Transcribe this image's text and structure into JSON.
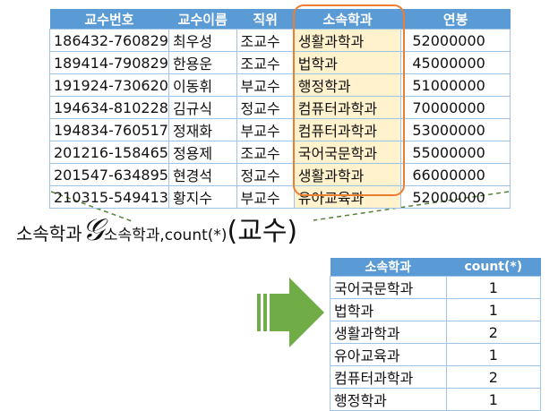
{
  "professor_table": {
    "headers": [
      "교수번호",
      "교수이름",
      "직위",
      "소속학과",
      "연봉"
    ],
    "rows": [
      [
        "186432-760829",
        "최우성",
        "조교수",
        "생활과학과",
        "52000000"
      ],
      [
        "189414-790829",
        "한용운",
        "조교수",
        "법학과",
        "45000000"
      ],
      [
        "191924-730620",
        "이동휘",
        "부교수",
        "행정학과",
        "51000000"
      ],
      [
        "194634-810228",
        "김규식",
        "정교수",
        "컴퓨터과학과",
        "70000000"
      ],
      [
        "194834-760517",
        "정재화",
        "부교수",
        "컴퓨터과학과",
        "53000000"
      ],
      [
        "201216-158465",
        "정용제",
        "조교수",
        "국어국문학과",
        "55000000"
      ],
      [
        "201547-634895",
        "현경석",
        "정교수",
        "생활과학과",
        "66000000"
      ],
      [
        "210315-549413",
        "황지수",
        "부교수",
        "유아교육과",
        "52000000"
      ]
    ]
  },
  "expression": {
    "grouping_attr": "소속학과",
    "gamma_symbol": "𝒢",
    "functions": "소속학과,count(*)",
    "relation": "(교수)"
  },
  "result_table": {
    "headers": [
      "소속학과",
      "count(*)"
    ],
    "rows": [
      [
        "국어국문학과",
        "1"
      ],
      [
        "법학과",
        "1"
      ],
      [
        "생활과학과",
        "2"
      ],
      [
        "유아교육과",
        "1"
      ],
      [
        "컴퓨터과학과",
        "2"
      ],
      [
        "행정학과",
        "1"
      ]
    ]
  },
  "colors": {
    "header_blue": "#5b9bd5",
    "highlight_orange": "#ed7d31",
    "arrow_green": "#70ad47",
    "dashed_green": "#548235"
  }
}
